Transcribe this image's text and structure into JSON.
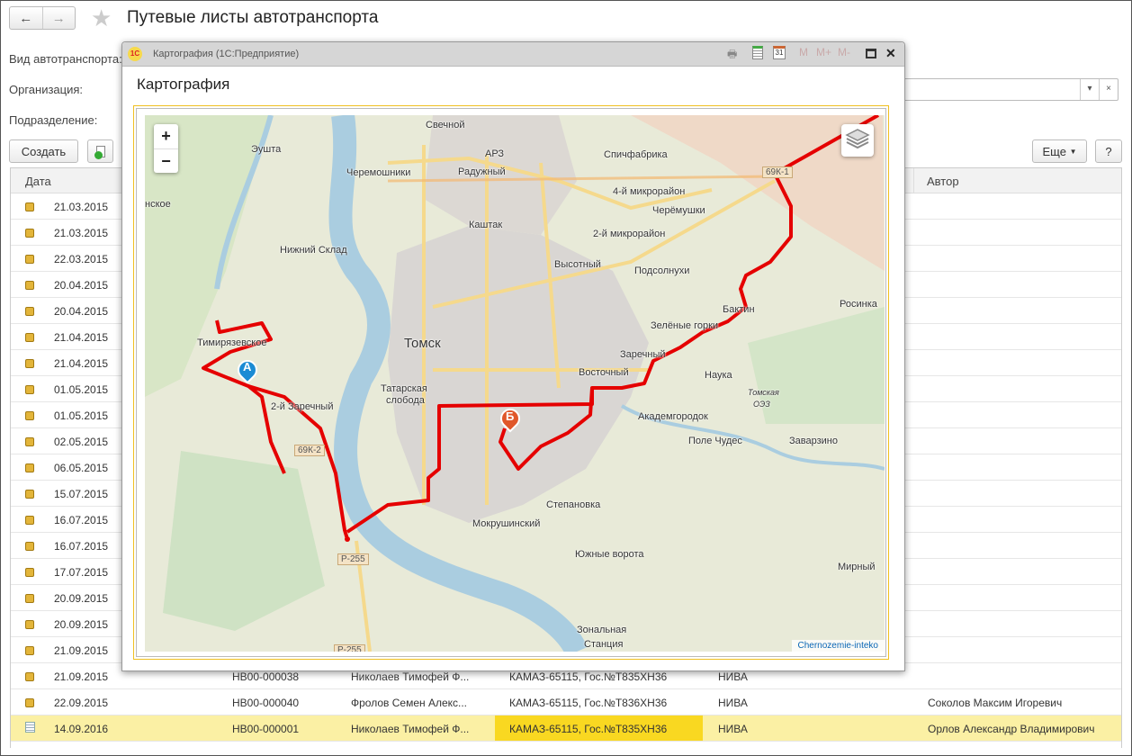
{
  "window": {
    "title": "Путевые листы автотранспорта",
    "back": "←",
    "forward": "→"
  },
  "filters": {
    "transport_type": "Вид автотранспорта:",
    "organization": "Организация:",
    "division": "Подразделение:",
    "clear": "×",
    "dropdown": "▾"
  },
  "toolbar": {
    "create": "Создать",
    "more": "Еще",
    "help": "?"
  },
  "table": {
    "headers": {
      "date": "Дата",
      "author": "Автор"
    },
    "rows": [
      {
        "date": "21.03.2015"
      },
      {
        "date": "21.03.2015"
      },
      {
        "date": "22.03.2015"
      },
      {
        "date": "20.04.2015"
      },
      {
        "date": "20.04.2015"
      },
      {
        "date": "21.04.2015"
      },
      {
        "date": "21.04.2015"
      },
      {
        "date": "01.05.2015"
      },
      {
        "date": "01.05.2015"
      },
      {
        "date": "02.05.2015"
      },
      {
        "date": "06.05.2015"
      },
      {
        "date": "15.07.2015"
      },
      {
        "date": "16.07.2015"
      },
      {
        "date": "16.07.2015"
      },
      {
        "date": "17.07.2015"
      },
      {
        "date": "20.09.2015"
      },
      {
        "date": "20.09.2015"
      },
      {
        "date": "21.09.2015"
      },
      {
        "date": "21.09.2015",
        "number": "НВ00-000038",
        "driver": "Николаев Тимофей Ф...",
        "vehicle": "КАМАЗ-65115, Гос.№Т835ХН36",
        "org": "НИВА",
        "author": ""
      },
      {
        "date": "22.09.2015",
        "number": "НВ00-000040",
        "driver": "Фролов Семен Алекс...",
        "vehicle": "КАМАЗ-65115, Гос.№Т836ХН36",
        "org": "НИВА",
        "author": "Соколов Максим Игоревич"
      },
      {
        "date": "14.09.2016",
        "number": "НВ00-000001",
        "driver": "Николаев Тимофей Ф...",
        "vehicle": "КАМАЗ-65115, Гос.№Т835ХН36",
        "org": "НИВА",
        "author": "Орлов Александр Владимирович"
      }
    ]
  },
  "dialog": {
    "window_title": "Картография  (1С:Предприятие)",
    "logo": "1С",
    "heading": "Картография",
    "toolbar": {
      "m": "M",
      "mplus": "M+",
      "mminus": "M-",
      "calendar_day": "31",
      "close": "✕"
    }
  },
  "map": {
    "zoom_in": "+",
    "zoom_out": "−",
    "attribution": "Chernozemie-inteko",
    "markers": {
      "start": "А",
      "end": "Б"
    },
    "route_color": "#e50000",
    "labels": {
      "svechnoy": "Свечной",
      "arz": "АРЗ",
      "eushta": "Эушта",
      "cheremoshniki": "Черемошники",
      "raduzhny": "Радужный",
      "spichfabrika": "Спичфабрика",
      "mkr4": "4-й микрорайон",
      "cheryomushki": "Черёмушки",
      "kashtak": "Каштак",
      "nskoe": "нское",
      "nizhny_sklad": "Нижний Склад",
      "mkr2": "2-й микрорайон",
      "vysotny": "Высотный",
      "podsolnukhi": "Подсолнухи",
      "rosinka": "Росинка",
      "baktin": "Бактин",
      "zelenye_gorki": "Зелёные горки",
      "tomsk": "Томск",
      "timiryazevskoe": "Тимирязевское",
      "zarechny": "Заречный",
      "vostochny": "Восточный",
      "nauka": "Наука",
      "tatarskaya": "Татарская",
      "sloboda": "слобода",
      "tomsk_oez1": "Томская",
      "tomsk_oez2": "ОЭЗ",
      "zarechny2": "2-й Заречный",
      "akademgorodok": "Академгородок",
      "pole_chudes": "Поле Чудес",
      "zavarzino": "Заварзино",
      "stepanovka": "Степановка",
      "mokrushinsky": "Мокрушинский",
      "yuzhnye_vorota": "Южные ворота",
      "mirny": "Мирный",
      "zonalnaya": "Зональная",
      "stantsiya": "Станция"
    },
    "road_shields": {
      "k1": "69К-1",
      "k2": "69К-2",
      "r255": "Р-255",
      "r255b": "Р-255"
    }
  }
}
